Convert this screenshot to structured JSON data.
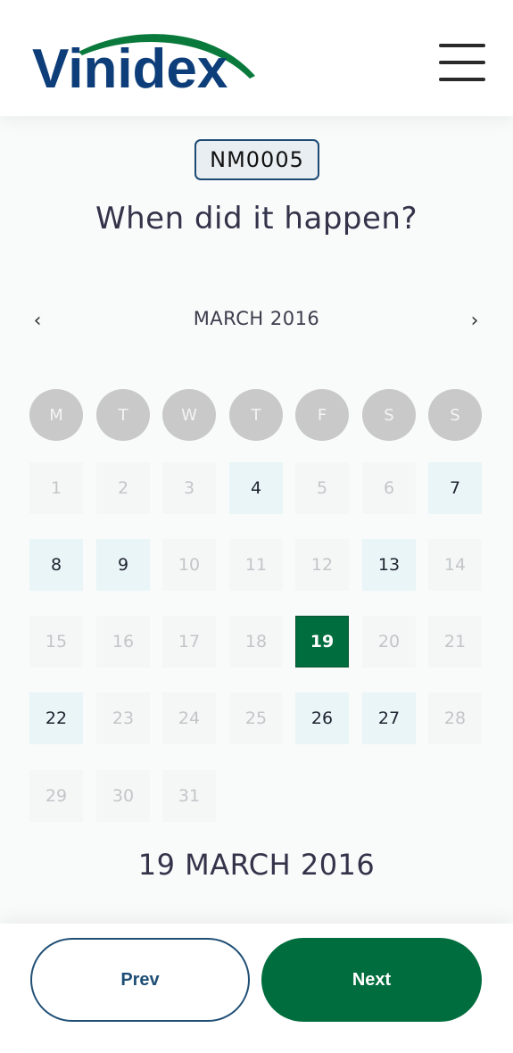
{
  "header": {
    "logo_text": "Vinidex",
    "logo_colors": {
      "primary": "#0e3e7a",
      "accent": "#0a7a3c"
    },
    "menu_icon": "hamburger-menu-icon"
  },
  "incident": {
    "reference": "NM0005",
    "question": "When did it happen?"
  },
  "calendar": {
    "prev_icon": "‹",
    "next_icon": "›",
    "month_label": "MARCH 2016",
    "weekdays": [
      "M",
      "T",
      "W",
      "T",
      "F",
      "S",
      "S"
    ],
    "days": [
      {
        "label": "1",
        "state": "disabled"
      },
      {
        "label": "2",
        "state": "disabled"
      },
      {
        "label": "3",
        "state": "disabled"
      },
      {
        "label": "4",
        "state": "enabled"
      },
      {
        "label": "5",
        "state": "disabled"
      },
      {
        "label": "6",
        "state": "disabled"
      },
      {
        "label": "7",
        "state": "enabled"
      },
      {
        "label": "8",
        "state": "enabled"
      },
      {
        "label": "9",
        "state": "enabled"
      },
      {
        "label": "10",
        "state": "disabled"
      },
      {
        "label": "11",
        "state": "disabled"
      },
      {
        "label": "12",
        "state": "disabled"
      },
      {
        "label": "13",
        "state": "enabled"
      },
      {
        "label": "14",
        "state": "disabled"
      },
      {
        "label": "15",
        "state": "disabled"
      },
      {
        "label": "16",
        "state": "disabled"
      },
      {
        "label": "17",
        "state": "disabled"
      },
      {
        "label": "18",
        "state": "disabled"
      },
      {
        "label": "19",
        "state": "selected"
      },
      {
        "label": "20",
        "state": "disabled"
      },
      {
        "label": "21",
        "state": "disabled"
      },
      {
        "label": "22",
        "state": "enabled"
      },
      {
        "label": "23",
        "state": "disabled"
      },
      {
        "label": "24",
        "state": "disabled"
      },
      {
        "label": "25",
        "state": "disabled"
      },
      {
        "label": "26",
        "state": "enabled"
      },
      {
        "label": "27",
        "state": "enabled"
      },
      {
        "label": "28",
        "state": "disabled"
      },
      {
        "label": "29",
        "state": "disabled"
      },
      {
        "label": "30",
        "state": "disabled"
      },
      {
        "label": "31",
        "state": "disabled"
      }
    ],
    "selected_date_label": "19 MARCH 2016"
  },
  "footer": {
    "prev_label": "Prev",
    "next_label": "Next"
  },
  "colors": {
    "accent_green": "#006d3e",
    "navy": "#1f4e75"
  }
}
